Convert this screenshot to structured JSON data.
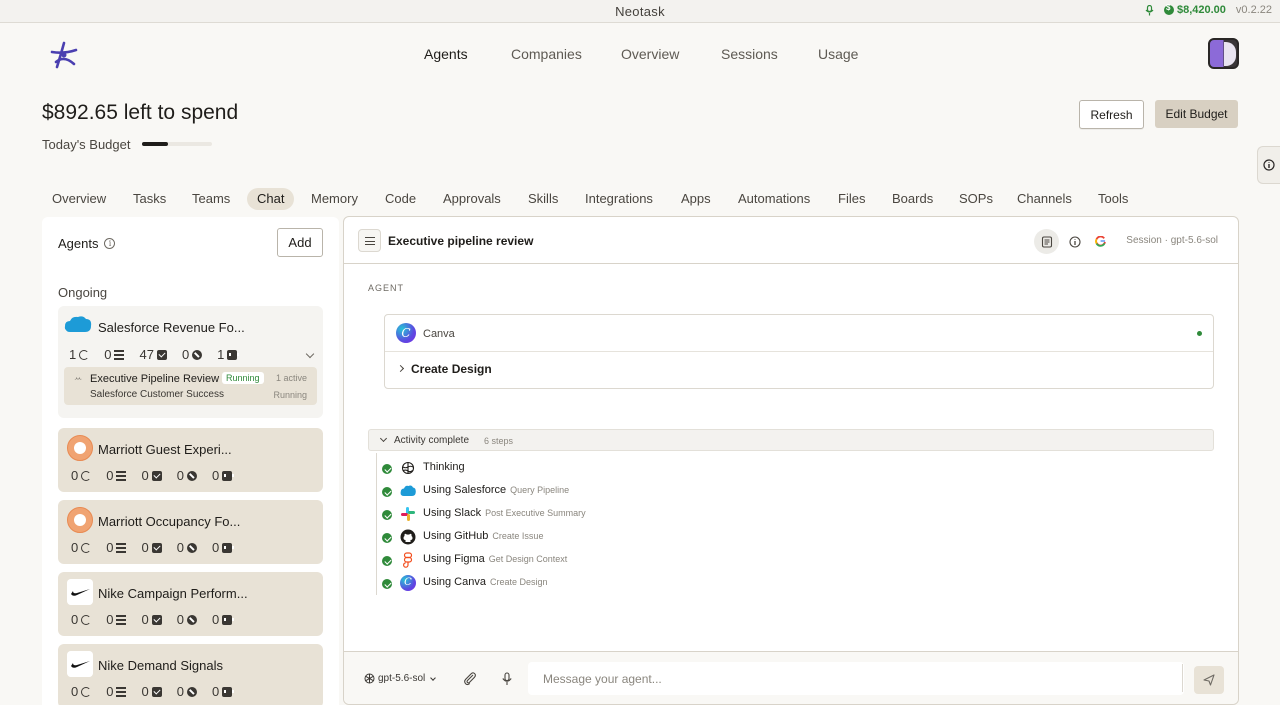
{
  "window": {
    "title": "Neotask",
    "balance": "$8,420.00",
    "version": "v0.2.22"
  },
  "topnav": {
    "items": [
      "Agents",
      "Companies",
      "Overview",
      "Sessions",
      "Usage"
    ],
    "active": "Agents"
  },
  "budget": {
    "title": "$892.65 left to spend",
    "label": "Today's Budget",
    "fill_fraction": 0.37,
    "refresh_label": "Refresh",
    "edit_label": "Edit Budget"
  },
  "subtabs": {
    "items": [
      "Overview",
      "Tasks",
      "Teams",
      "Chat",
      "Memory",
      "Code",
      "Approvals",
      "Skills",
      "Integrations",
      "Apps",
      "Automations",
      "Files",
      "Boards",
      "SOPs",
      "Channels",
      "Tools"
    ],
    "active": "Chat"
  },
  "agents_panel": {
    "title": "Agents",
    "add_label": "Add",
    "section": "Ongoing",
    "cards": [
      {
        "name": "Salesforce Revenue Fo...",
        "icon": "salesforce-icon",
        "stats": [
          "1",
          "0",
          "47",
          "0",
          "1"
        ],
        "session": {
          "name": "Executive Pipeline Review",
          "status": "Running",
          "active": "1 active",
          "sub": "Salesforce Customer Success",
          "sub_status": "Running"
        }
      },
      {
        "name": "Marriott Guest Experi...",
        "icon": "marriott-icon",
        "stats": [
          "0",
          "0",
          "0",
          "0",
          "0"
        ]
      },
      {
        "name": "Marriott Occupancy Fo...",
        "icon": "marriott-icon",
        "stats": [
          "0",
          "0",
          "0",
          "0",
          "0"
        ]
      },
      {
        "name": "Nike Campaign Perform...",
        "icon": "nike-icon",
        "stats": [
          "0",
          "0",
          "0",
          "0",
          "0"
        ]
      },
      {
        "name": "Nike Demand Signals",
        "icon": "nike-icon",
        "stats": [
          "0",
          "0",
          "0",
          "0",
          "0"
        ]
      }
    ]
  },
  "chat": {
    "title": "Executive pipeline review",
    "session_label": "Session · gpt-5.6-sol",
    "role_label": "AGENT",
    "tool_card": {
      "app": "Canva",
      "action": "Create Design",
      "status_color": "#2f8a3a"
    },
    "activity": {
      "label": "Activity complete",
      "count": "6 steps"
    },
    "steps": [
      {
        "name": "Thinking",
        "detail": "",
        "icon": "brain-icon"
      },
      {
        "name": "Using Salesforce",
        "detail": "Query Pipeline",
        "icon": "salesforce-icon"
      },
      {
        "name": "Using Slack",
        "detail": "Post Executive Summary",
        "icon": "slack-icon"
      },
      {
        "name": "Using GitHub",
        "detail": "Create Issue",
        "icon": "github-icon"
      },
      {
        "name": "Using Figma",
        "detail": "Get Design Context",
        "icon": "figma-icon"
      },
      {
        "name": "Using Canva",
        "detail": "Create Design",
        "icon": "canva-icon"
      }
    ],
    "composer": {
      "model": "gpt-5.6-sol",
      "placeholder": "Message your agent..."
    }
  },
  "colors": {
    "accent_green": "#2f8a3a",
    "tab_active_bg": "#e8e2d6",
    "edit_button_bg": "#d8d0c2"
  }
}
